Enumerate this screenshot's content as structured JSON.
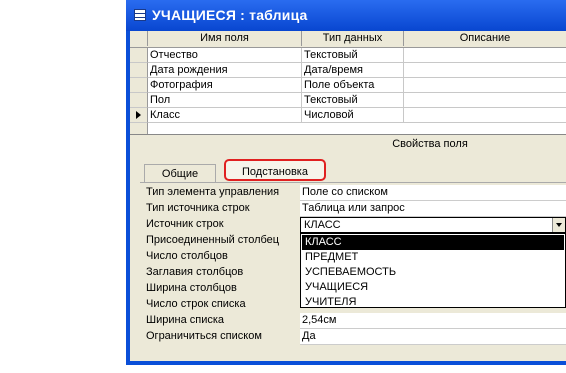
{
  "window": {
    "title": "УЧАЩИЕСЯ : таблица"
  },
  "grid": {
    "headers": {
      "field_name": "Имя поля",
      "data_type": "Тип данных",
      "description": "Описание"
    },
    "rows": [
      {
        "name": "Отчество",
        "type": "Текстовый"
      },
      {
        "name": "Дата рождения",
        "type": "Дата/время"
      },
      {
        "name": "Фотография",
        "type": "Поле объекта"
      },
      {
        "name": "Пол",
        "type": "Текстовый"
      },
      {
        "name": "Класс",
        "type": "Числовой"
      }
    ]
  },
  "properties": {
    "title": "Свойства поля",
    "tabs": {
      "general": "Общие",
      "lookup": "Подстановка"
    },
    "display_control": {
      "label": "Тип элемента управления",
      "value": "Поле со списком"
    },
    "row_source_type": {
      "label": "Тип источника строк",
      "value": "Таблица или запрос"
    },
    "row_source": {
      "label": "Источник строк",
      "value": "КЛАСС"
    },
    "bound_column": {
      "label": "Присоединенный столбец"
    },
    "column_count": {
      "label": "Число столбцов"
    },
    "column_heads": {
      "label": "Заглавия столбцов"
    },
    "column_widths": {
      "label": "Ширина столбцов"
    },
    "list_rows": {
      "label": "Число строк списка"
    },
    "list_width": {
      "label": "Ширина списка",
      "value": "2,54см"
    },
    "limit_to_list": {
      "label": "Ограничиться списком",
      "value": "Да"
    }
  },
  "dropdown": {
    "options": [
      "КЛАСС",
      "ПРЕДМЕТ",
      "УСПЕВАЕМОСТЬ",
      "УЧАЩИЕСЯ",
      "УЧИТЕЛЯ"
    ],
    "selected": "КЛАСС"
  }
}
